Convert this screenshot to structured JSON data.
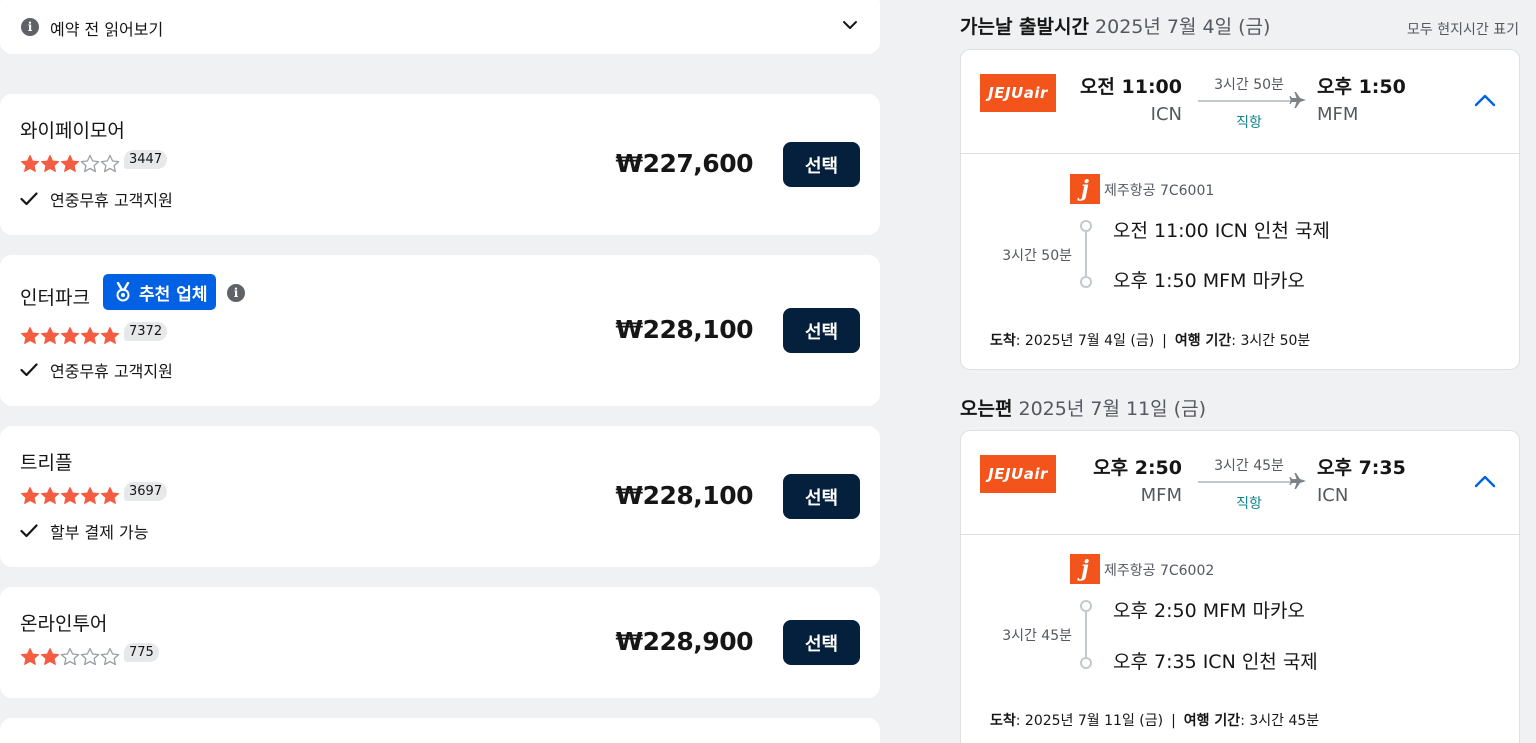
{
  "notice": {
    "label": "예약 전 읽어보기",
    "info_icon": "i"
  },
  "providers": [
    {
      "name": "와이페이모어",
      "rating": 3,
      "reviews": "3447",
      "feature": "연중무휴 고객지원",
      "price": "₩227,600",
      "select_label": "선택"
    },
    {
      "name": "인터파크",
      "badge": "추천 업체",
      "rating": 5,
      "reviews": "7372",
      "feature": "연중무휴 고객지원",
      "price": "₩228,100",
      "select_label": "선택"
    },
    {
      "name": "트리플",
      "rating": 5,
      "reviews": "3697",
      "feature": "할부 결제 가능",
      "price": "₩228,100",
      "select_label": "선택"
    },
    {
      "name": "온라인투어",
      "rating": 2,
      "reviews": "775",
      "price": "₩228,900",
      "select_label": "선택"
    }
  ],
  "outbound": {
    "heading_bold": "가는날 출발시간",
    "heading_date": "2025년 7월 4일 (금)",
    "local_time_note": "모두 현지시간 표기",
    "airline_logo": "JEJUair",
    "dep_time": "오전 11:00",
    "dep_code": "ICN",
    "duration": "3시간 50분",
    "direct": "직항",
    "arr_time": "오후 1:50",
    "arr_code": "MFM",
    "airline_flight": "제주항공 7C6001",
    "seg_duration": "3시간 50분",
    "stop1": "오전 11:00 ICN 인천 국제",
    "stop2": "오후 1:50 MFM 마카오",
    "arrive_label": "도착",
    "arrive_value": ": 2025년 7월 4일 (금)",
    "travel_label": "여행 기간",
    "travel_value": ": 3시간 50분"
  },
  "inbound": {
    "heading_bold": "오는편",
    "heading_date": "2025년 7월 11일 (금)",
    "airline_logo": "JEJUair",
    "dep_time": "오후 2:50",
    "dep_code": "MFM",
    "duration": "3시간 45분",
    "direct": "직항",
    "arr_time": "오후 7:35",
    "arr_code": "ICN",
    "airline_flight": "제주항공 7C6002",
    "seg_duration": "3시간 45분",
    "stop1": "오후 2:50 MFM 마카오",
    "stop2": "오후 7:35 ICN 인천 국제",
    "arrive_label": "도착",
    "arrive_value": ": 2025년 7월 11일 (금)",
    "travel_label": "여행 기간",
    "travel_value": ": 3시간 45분"
  },
  "separator": "|",
  "j_logo": "j",
  "colors": {
    "star": "#f55d42",
    "select": "#05203c",
    "badge": "#0062e3",
    "jeju": "#f2541b",
    "direct": "#0c838a"
  },
  "icons": [
    "info-icon",
    "chevron-down-icon",
    "star-icon",
    "check-icon",
    "medal-icon",
    "plane-icon",
    "chevron-up-icon"
  ]
}
